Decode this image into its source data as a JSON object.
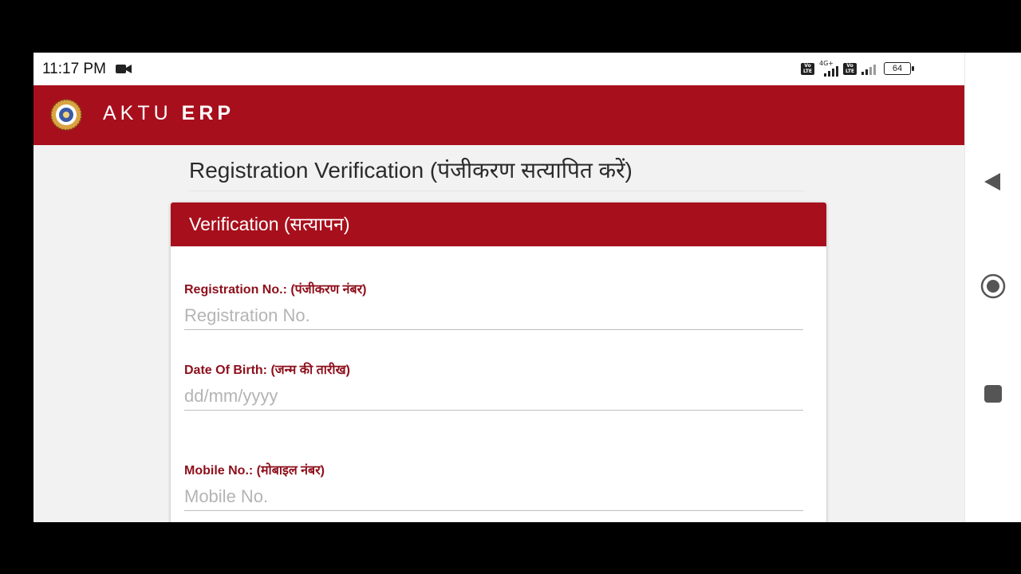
{
  "status_bar": {
    "time": "11:17 PM",
    "network_type": "4G+",
    "battery": "64"
  },
  "header": {
    "brand_light": "AKTU",
    "brand_bold": "ERP"
  },
  "page": {
    "title": "Registration Verification (पंजीकरण सत्यापित करें)"
  },
  "card": {
    "title": "Verification (सत्यापन)",
    "fields": [
      {
        "label": "Registration No.: (पंजीकरण नंबर)",
        "placeholder": "Registration No."
      },
      {
        "label": "Date Of Birth: (जन्म की तारीख)",
        "placeholder": "dd/mm/yyyy"
      },
      {
        "label": "Mobile No.: (मोबाइल नंबर)",
        "placeholder": "Mobile No."
      }
    ]
  },
  "colors": {
    "brand_red": "#a80f1c",
    "label_red": "#8e0f1b"
  },
  "icons": [
    "video-camera-icon",
    "volte-icon",
    "signal-icon",
    "battery-icon",
    "aktu-logo-icon",
    "back-icon",
    "home-icon",
    "recents-icon"
  ]
}
